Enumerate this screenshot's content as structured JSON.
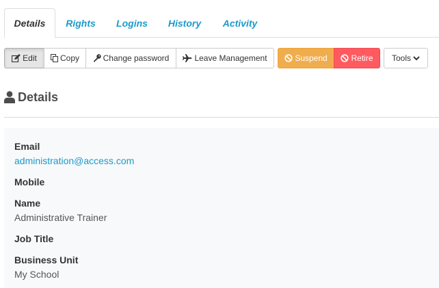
{
  "tabs": [
    {
      "label": "Details",
      "active": true
    },
    {
      "label": "Rights",
      "active": false
    },
    {
      "label": "Logins",
      "active": false
    },
    {
      "label": "History",
      "active": false
    },
    {
      "label": "Activity",
      "active": false
    }
  ],
  "toolbar": {
    "edit_label": "Edit",
    "copy_label": "Copy",
    "change_password_label": "Change password",
    "leave_management_label": "Leave Management",
    "suspend_label": "Suspend",
    "retire_label": "Retire",
    "tools_label": "Tools"
  },
  "section": {
    "title": "Details",
    "icon": "user-icon"
  },
  "details": {
    "email_label": "Email",
    "email_value": "administration@access.com",
    "mobile_label": "Mobile",
    "mobile_value": "",
    "name_label": "Name",
    "name_value": "Administrative Trainer",
    "job_title_label": "Job Title",
    "job_title_value": "",
    "business_unit_label": "Business Unit",
    "business_unit_value": "My School"
  },
  "colors": {
    "link": "#1a9bc9",
    "suspend": "#f0ad4e",
    "retire": "#ff5a5f",
    "panel": "#f8f9fb"
  }
}
